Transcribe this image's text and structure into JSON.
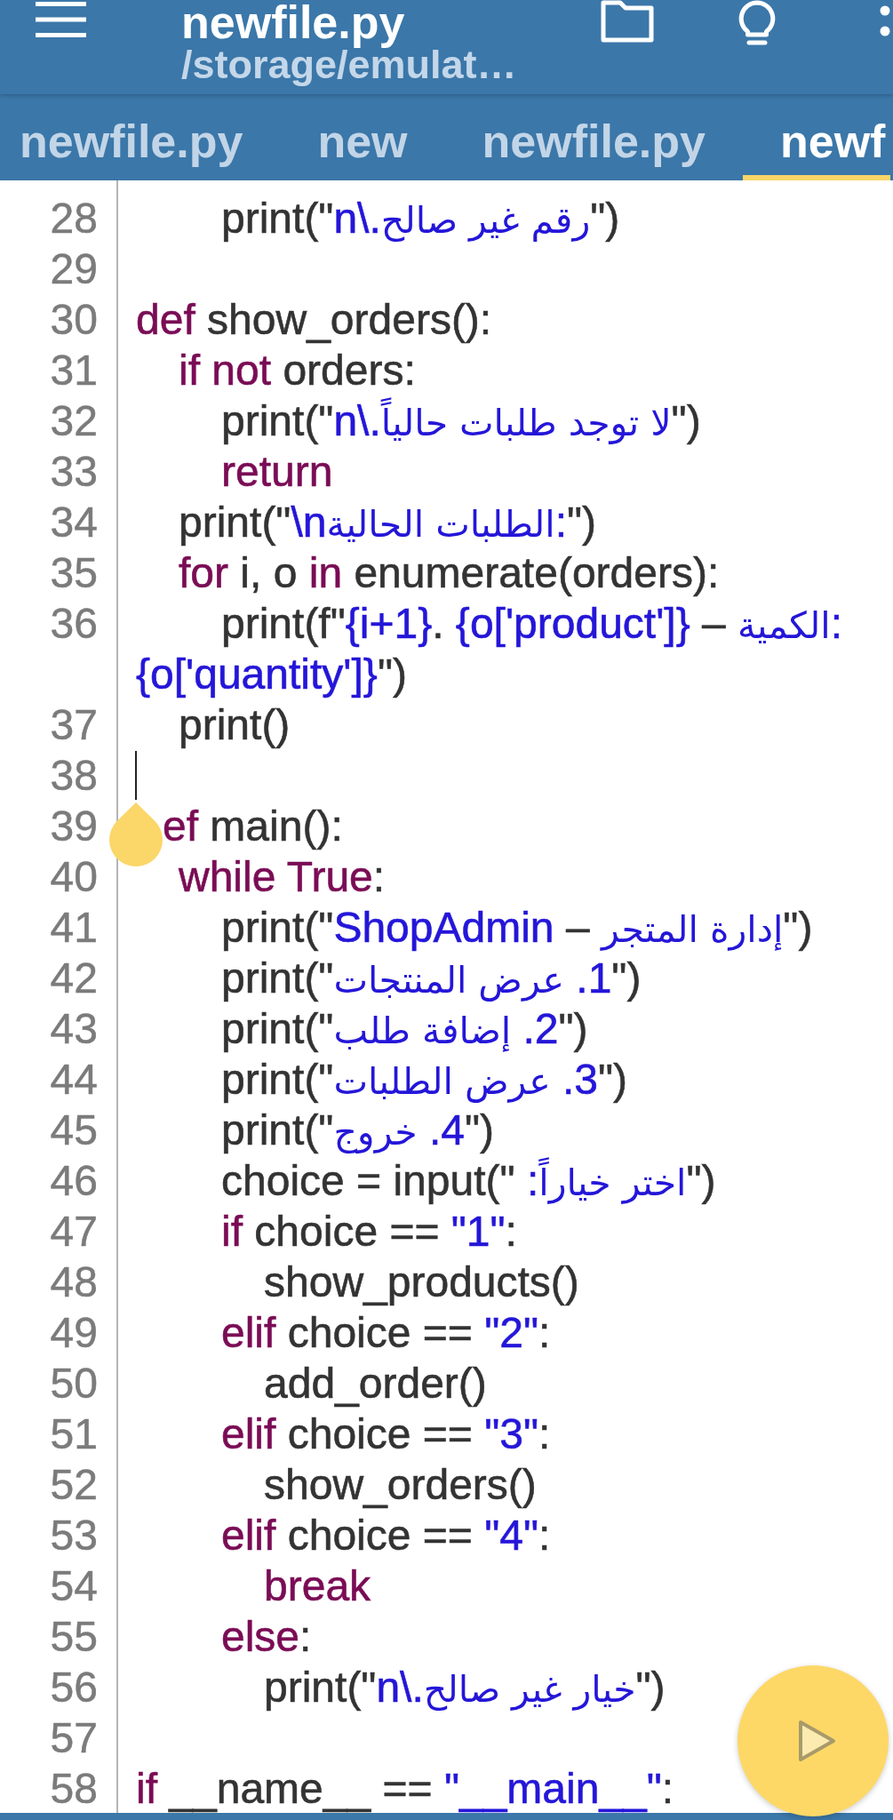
{
  "app_bar": {
    "title": "newfile.py",
    "subtitle": "/storage/emulat…"
  },
  "tabs": [
    {
      "label": "newfile.py",
      "selected": false
    },
    {
      "label": "new",
      "selected": false
    },
    {
      "label": "newfile.py",
      "selected": false
    },
    {
      "label": "newf",
      "selected": true
    }
  ],
  "editor": {
    "lines": [
      {
        "children": [
          {
            "children": [
              {
                "number": "28",
                "tokens": [
                  {
                    "kind": "plain",
                    "text": "print(\""
                  },
                  {
                    "kind": "string",
                    "text": "n\\."
                  },
                  {
                    "kind": "arabic",
                    "text": "رقم غير صالح"
                  },
                  {
                    "kind": "plain",
                    "text": "\")"
                  }
                ]
              }
            ]
          }
        ]
      },
      {
        "number": "29"
      },
      {
        "number": "30",
        "tokens": [
          {
            "kind": "keyword",
            "text": "def"
          },
          {
            "kind": "plain",
            "text": " show_orders():"
          }
        ],
        "children": [
          {
            "number": "31",
            "tokens": [
              {
                "kind": "keyword",
                "text": "if not"
              },
              {
                "kind": "plain",
                "text": " orders:"
              }
            ],
            "children": [
              {
                "number": "32",
                "tokens": [
                  {
                    "kind": "plain",
                    "text": "print(\""
                  },
                  {
                    "kind": "string",
                    "text": "n\\."
                  },
                  {
                    "kind": "arabic",
                    "text": "لا توجد طلبات حالياً"
                  },
                  {
                    "kind": "plain",
                    "text": "\")"
                  }
                ]
              },
              {
                "number": "33",
                "tokens": [
                  {
                    "kind": "keyword",
                    "text": "return"
                  }
                ]
              }
            ]
          },
          {
            "number": "34",
            "tokens": [
              {
                "kind": "plain",
                "text": "print(\""
              },
              {
                "kind": "string",
                "text": "\\n"
              },
              {
                "kind": "arabic",
                "text": "الطلبات الحالية"
              },
              {
                "kind": "string",
                "text": ":"
              },
              {
                "kind": "plain",
                "text": "\")"
              }
            ]
          },
          {
            "number": "35",
            "tokens": [
              {
                "kind": "keyword",
                "text": "for"
              },
              {
                "kind": "plain",
                "text": " i, o "
              },
              {
                "kind": "keyword",
                "text": "in"
              },
              {
                "kind": "plain",
                "text": " enumerate(orders):"
              }
            ],
            "children": [
              {
                "number": "36",
                "tokens": [
                  {
                    "kind": "plain",
                    "text": "print(f\""
                  },
                  {
                    "kind": "string",
                    "text": "{i+1}"
                  },
                  {
                    "kind": "plain",
                    "text": ". "
                  },
                  {
                    "kind": "string",
                    "text": "{o['product']}"
                  },
                  {
                    "kind": "plain",
                    "text": " – "
                  },
                  {
                    "kind": "arabic",
                    "text": "الكمية"
                  },
                  {
                    "kind": "string",
                    "text": ":"
                  }
                ],
                "continuation": [
                  {
                    "kind": "string",
                    "text": "{o['quantity']}"
                  },
                  {
                    "kind": "plain",
                    "text": "\")"
                  }
                ]
              }
            ]
          },
          {
            "number": "37",
            "tokens": [
              {
                "kind": "plain",
                "text": "print()"
              }
            ]
          }
        ]
      },
      {
        "number": "38",
        "caret": true
      },
      {
        "number": "39",
        "selection_handle": true,
        "tokens": [
          {
            "kind": "keyword",
            "text": "ef"
          },
          {
            "kind": "plain",
            "text": " main():"
          }
        ],
        "children": [
          {
            "number": "40",
            "tokens": [
              {
                "kind": "keyword",
                "text": "while True"
              },
              {
                "kind": "plain",
                "text": ":"
              }
            ],
            "children": [
              {
                "number": "41",
                "tokens": [
                  {
                    "kind": "plain",
                    "text": "print(\""
                  },
                  {
                    "kind": "string",
                    "text": "ShopAdmin"
                  },
                  {
                    "kind": "plain",
                    "text": " – "
                  },
                  {
                    "kind": "arabic",
                    "text": "إدارة المتجر"
                  },
                  {
                    "kind": "plain",
                    "text": "\")"
                  }
                ]
              },
              {
                "number": "42",
                "tokens": [
                  {
                    "kind": "plain",
                    "text": "print(\""
                  },
                  {
                    "kind": "arabic",
                    "text": "عرض المنتجات"
                  },
                  {
                    "kind": "string",
                    "text": " .1"
                  },
                  {
                    "kind": "plain",
                    "text": "\")"
                  }
                ]
              },
              {
                "number": "43",
                "tokens": [
                  {
                    "kind": "plain",
                    "text": "print(\""
                  },
                  {
                    "kind": "arabic",
                    "text": "إضافة طلب"
                  },
                  {
                    "kind": "string",
                    "text": " .2"
                  },
                  {
                    "kind": "plain",
                    "text": "\")"
                  }
                ]
              },
              {
                "number": "44",
                "tokens": [
                  {
                    "kind": "plain",
                    "text": "print(\""
                  },
                  {
                    "kind": "arabic",
                    "text": "عرض الطلبات"
                  },
                  {
                    "kind": "string",
                    "text": " .3"
                  },
                  {
                    "kind": "plain",
                    "text": "\")"
                  }
                ]
              },
              {
                "number": "45",
                "tokens": [
                  {
                    "kind": "plain",
                    "text": "print(\""
                  },
                  {
                    "kind": "arabic",
                    "text": "خروج"
                  },
                  {
                    "kind": "string",
                    "text": " .4"
                  },
                  {
                    "kind": "plain",
                    "text": "\")"
                  }
                ]
              },
              {
                "number": "46",
                "tokens": [
                  {
                    "kind": "plain",
                    "text": "choice = input(\""
                  },
                  {
                    "kind": "string",
                    "text": " :"
                  },
                  {
                    "kind": "arabic",
                    "text": "اختر خياراً"
                  },
                  {
                    "kind": "plain",
                    "text": "\")"
                  }
                ]
              },
              {
                "number": "47",
                "tokens": [
                  {
                    "kind": "keyword",
                    "text": "if"
                  },
                  {
                    "kind": "plain",
                    "text": " choice == "
                  },
                  {
                    "kind": "string",
                    "text": "\"1\""
                  },
                  {
                    "kind": "plain",
                    "text": ":"
                  }
                ],
                "children": [
                  {
                    "number": "48",
                    "tokens": [
                      {
                        "kind": "plain",
                        "text": "show_products()"
                      }
                    ]
                  }
                ]
              },
              {
                "number": "49",
                "tokens": [
                  {
                    "kind": "keyword",
                    "text": "elif"
                  },
                  {
                    "kind": "plain",
                    "text": " choice == "
                  },
                  {
                    "kind": "string",
                    "text": "\"2\""
                  },
                  {
                    "kind": "plain",
                    "text": ":"
                  }
                ],
                "children": [
                  {
                    "number": "50",
                    "tokens": [
                      {
                        "kind": "plain",
                        "text": "add_order()"
                      }
                    ]
                  }
                ]
              },
              {
                "number": "51",
                "tokens": [
                  {
                    "kind": "keyword",
                    "text": "elif"
                  },
                  {
                    "kind": "plain",
                    "text": " choice == "
                  },
                  {
                    "kind": "string",
                    "text": "\"3\""
                  },
                  {
                    "kind": "plain",
                    "text": ":"
                  }
                ],
                "children": [
                  {
                    "number": "52",
                    "tokens": [
                      {
                        "kind": "plain",
                        "text": "show_orders()"
                      }
                    ]
                  }
                ]
              },
              {
                "number": "53",
                "tokens": [
                  {
                    "kind": "keyword",
                    "text": "elif"
                  },
                  {
                    "kind": "plain",
                    "text": " choice == "
                  },
                  {
                    "kind": "string",
                    "text": "\"4\""
                  },
                  {
                    "kind": "plain",
                    "text": ":"
                  }
                ],
                "children": [
                  {
                    "number": "54",
                    "tokens": [
                      {
                        "kind": "keyword",
                        "text": "break"
                      }
                    ]
                  }
                ]
              },
              {
                "number": "55",
                "tokens": [
                  {
                    "kind": "keyword",
                    "text": "else"
                  },
                  {
                    "kind": "plain",
                    "text": ":"
                  }
                ],
                "children": [
                  {
                    "number": "56",
                    "tokens": [
                      {
                        "kind": "plain",
                        "text": "print(\""
                      },
                      {
                        "kind": "string",
                        "text": "n\\."
                      },
                      {
                        "kind": "arabic",
                        "text": "خيار غير صالح"
                      },
                      {
                        "kind": "plain",
                        "text": "\")"
                      }
                    ]
                  }
                ]
              }
            ]
          }
        ]
      },
      {
        "number": "57"
      },
      {
        "number": "58",
        "tokens": [
          {
            "kind": "keyword",
            "text": "if"
          },
          {
            "kind": "plain",
            "text": " __name__ == "
          },
          {
            "kind": "string",
            "text": "\"__main__\""
          },
          {
            "kind": "plain",
            "text": ":"
          }
        ]
      }
    ]
  }
}
